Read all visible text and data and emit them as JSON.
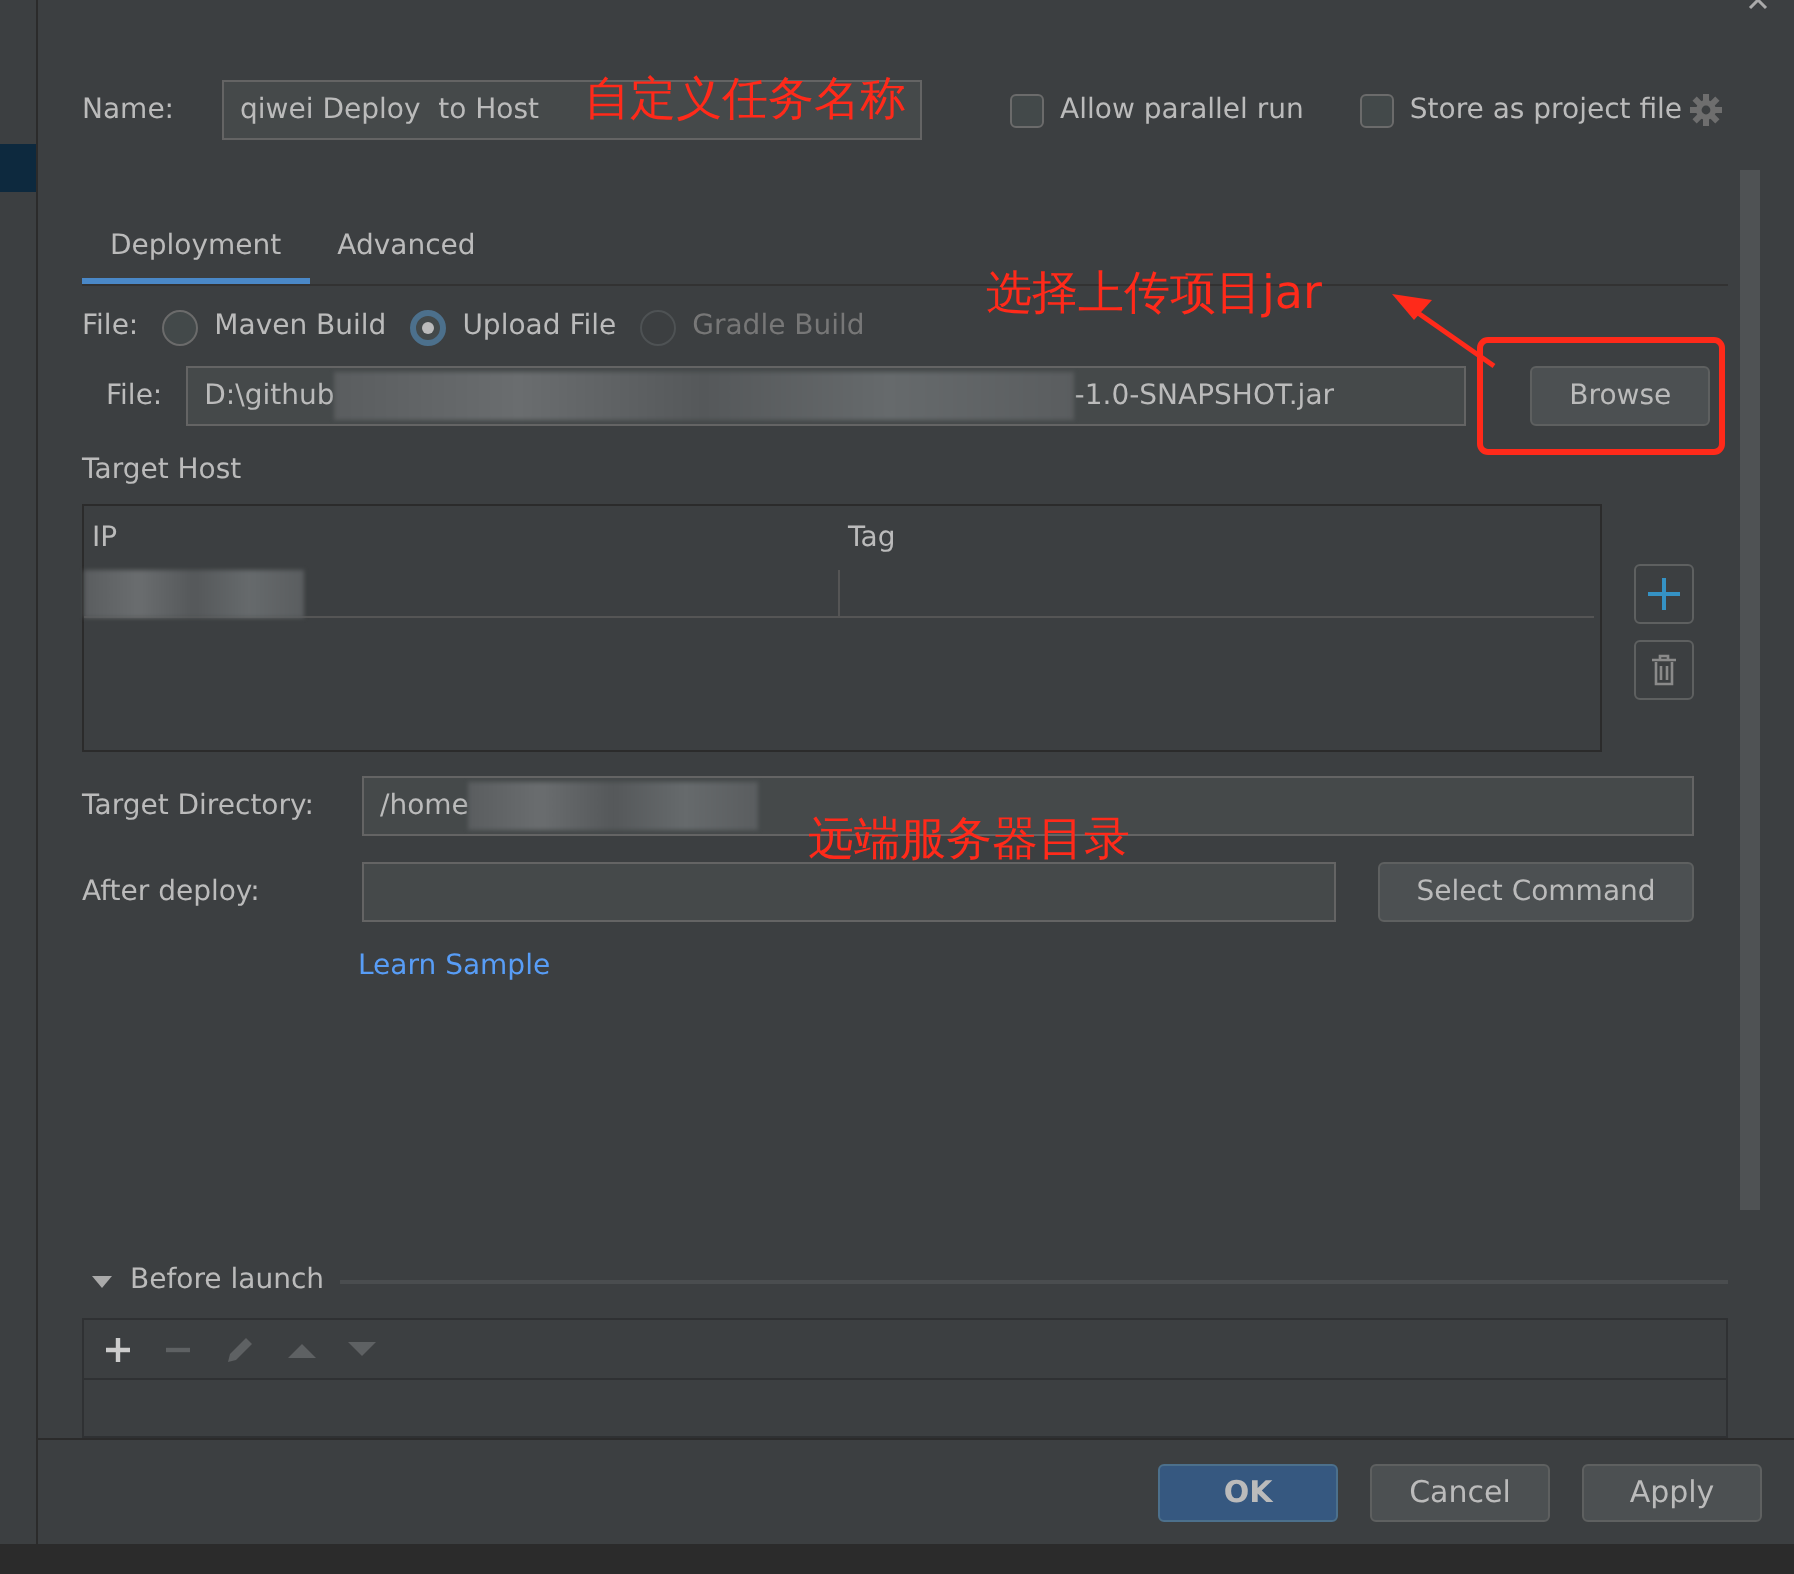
{
  "name_field": {
    "label": "Name:",
    "value": "qiwei Deploy  to Host"
  },
  "options": [
    {
      "label": "Allow parallel run",
      "checked": false
    },
    {
      "label": "Store as project file",
      "checked": false
    }
  ],
  "tabs": [
    {
      "label": "Deployment",
      "selected": true
    },
    {
      "label": "Advanced",
      "selected": false
    }
  ],
  "file_source": {
    "label": "File:",
    "options": [
      {
        "label": "Maven Build",
        "selected": false,
        "disabled": false
      },
      {
        "label": "Upload File",
        "selected": true,
        "disabled": false
      },
      {
        "label": "Gradle Build",
        "selected": false,
        "disabled": true
      }
    ]
  },
  "file_field": {
    "label": "File:",
    "value_start": "D:\\github",
    "value_end": "-1.0-SNAPSHOT.jar",
    "button": "Browse"
  },
  "target_host": {
    "title": "Target Host",
    "columns": [
      "IP",
      "Tag"
    ]
  },
  "target_directory": {
    "label": "Target Directory:",
    "value_start": "/home"
  },
  "after_deploy": {
    "label": "After deploy:",
    "button": "Select Command",
    "link": "Learn Sample"
  },
  "before_launch": {
    "title": "Before launch",
    "expanded": true
  },
  "buttons": [
    {
      "label": "OK",
      "kind": "primary"
    },
    {
      "label": "Cancel",
      "kind": "secondary"
    },
    {
      "label": "Apply",
      "kind": "secondary"
    }
  ],
  "annotations": [
    {
      "text": "自定义任务名称"
    },
    {
      "text": "选择上传项目jar"
    },
    {
      "text": "远端服务器目录"
    }
  ]
}
